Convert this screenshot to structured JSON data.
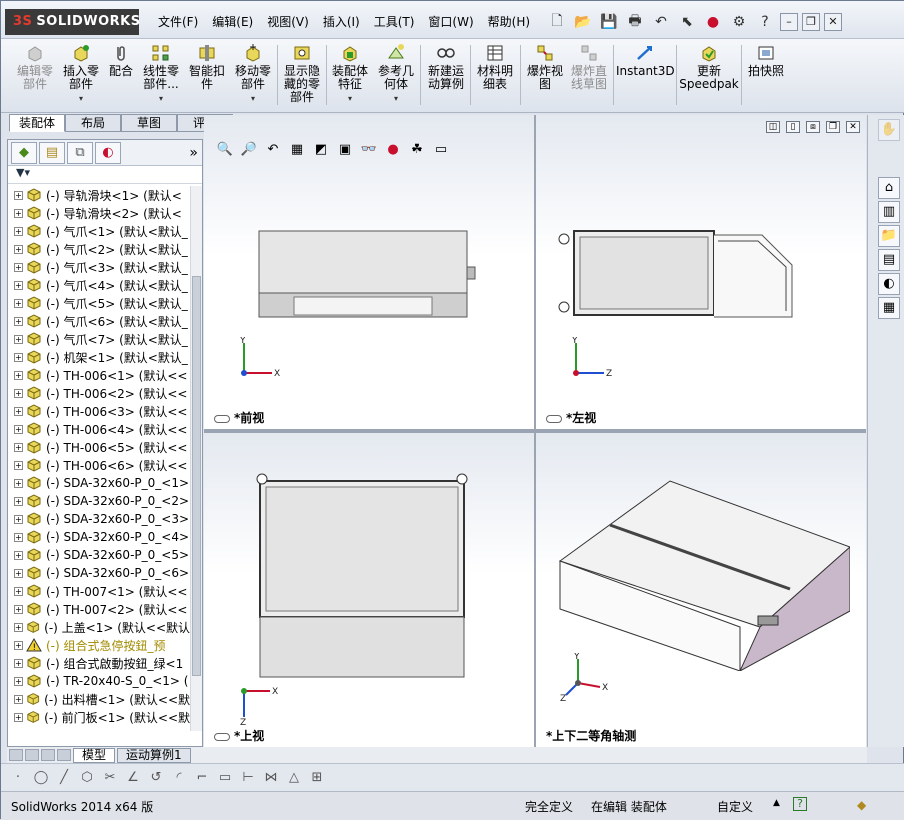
{
  "app": {
    "brand": "SOLIDWORKS",
    "brand_prefix": "3S"
  },
  "menus": [
    "文件(F)",
    "编辑(E)",
    "视图(V)",
    "插入(I)",
    "工具(T)",
    "窗口(W)",
    "帮助(H)"
  ],
  "commands": [
    {
      "label": "编辑零\n部件",
      "disabled": true
    },
    {
      "label": "插入零\n部件",
      "disabled": false
    },
    {
      "label": "配合",
      "disabled": false
    },
    {
      "label": "线性零\n部件...",
      "disabled": false
    },
    {
      "label": "智能扣\n件",
      "disabled": false
    },
    {
      "label": "移动零\n部件",
      "disabled": false
    },
    {
      "label": "显示隐\n藏的零\n部件",
      "disabled": false
    },
    {
      "label": "装配体\n特征",
      "disabled": false
    },
    {
      "label": "参考几\n何体",
      "disabled": false
    },
    {
      "label": "新建运\n动算例",
      "disabled": false
    },
    {
      "label": "材料明\n细表",
      "disabled": false
    },
    {
      "label": "爆炸视\n图",
      "disabled": false
    },
    {
      "label": "爆炸直\n线草图",
      "disabled": true
    },
    {
      "label": "Instant3D",
      "disabled": false
    },
    {
      "label": "更新\nSpeedpak",
      "disabled": false
    },
    {
      "label": "拍快照",
      "disabled": false
    }
  ],
  "cmd_tabs": [
    "装配体",
    "布局",
    "草图",
    "评估"
  ],
  "tree_items": [
    {
      "label": "(-) 导轨滑块<1> (默认<",
      "warn": false
    },
    {
      "label": "(-) 导轨滑块<2> (默认<",
      "warn": false
    },
    {
      "label": "(-) 气爪<1> (默认<默认_",
      "warn": false
    },
    {
      "label": "(-) 气爪<2> (默认<默认_",
      "warn": false
    },
    {
      "label": "(-) 气爪<3> (默认<默认_",
      "warn": false
    },
    {
      "label": "(-) 气爪<4> (默认<默认_",
      "warn": false
    },
    {
      "label": "(-) 气爪<5> (默认<默认_",
      "warn": false
    },
    {
      "label": "(-) 气爪<6> (默认<默认_",
      "warn": false
    },
    {
      "label": "(-) 气爪<7> (默认<默认_",
      "warn": false
    },
    {
      "label": "(-) 机架<1> (默认<默认_",
      "warn": false
    },
    {
      "label": "(-) TH-006<1> (默认<<",
      "warn": false
    },
    {
      "label": "(-) TH-006<2> (默认<<",
      "warn": false
    },
    {
      "label": "(-) TH-006<3> (默认<<",
      "warn": false
    },
    {
      "label": "(-) TH-006<4> (默认<<",
      "warn": false
    },
    {
      "label": "(-) TH-006<5> (默认<<",
      "warn": false
    },
    {
      "label": "(-) TH-006<6> (默认<<",
      "warn": false
    },
    {
      "label": "(-) SDA-32x60-P_0_<1>",
      "warn": false
    },
    {
      "label": "(-) SDA-32x60-P_0_<2>",
      "warn": false
    },
    {
      "label": "(-) SDA-32x60-P_0_<3>",
      "warn": false
    },
    {
      "label": "(-) SDA-32x60-P_0_<4>",
      "warn": false
    },
    {
      "label": "(-) SDA-32x60-P_0_<5>",
      "warn": false
    },
    {
      "label": "(-) SDA-32x60-P_0_<6>",
      "warn": false
    },
    {
      "label": "(-) TH-007<1> (默认<<",
      "warn": false
    },
    {
      "label": "(-) TH-007<2> (默认<<",
      "warn": false
    },
    {
      "label": "(-) 上盖<1> (默认<<默认",
      "warn": false
    },
    {
      "label": "(-) 组合式急停按鈕_预",
      "warn": true
    },
    {
      "label": "(-) 组合式啟動按鈕_绿<1",
      "warn": false
    },
    {
      "label": "(-) TR-20x40-S_0_<1> (",
      "warn": false
    },
    {
      "label": "(-) 出料槽<1> (默认<<默",
      "warn": false
    },
    {
      "label": "(-) 前门板<1> (默认<<默",
      "warn": false
    }
  ],
  "views": {
    "front": "*前视",
    "left": "*左视",
    "top": "*上视",
    "iso": "*上下二等角轴测"
  },
  "axes": {
    "x": "X",
    "y": "Y",
    "z": "Z"
  },
  "bottom_tabs": [
    "模型",
    "运动算例1"
  ],
  "status": {
    "version": "SolidWorks 2014 x64 版",
    "defined": "完全定义",
    "editing": "在编辑 装配体",
    "custom": "自定义",
    "help": "?"
  },
  "colors": {
    "part_fill": "#dcdcdc",
    "part_side": "#c9b8c9",
    "part_dark": "#8f8f8f",
    "accent": "#c8102e"
  }
}
